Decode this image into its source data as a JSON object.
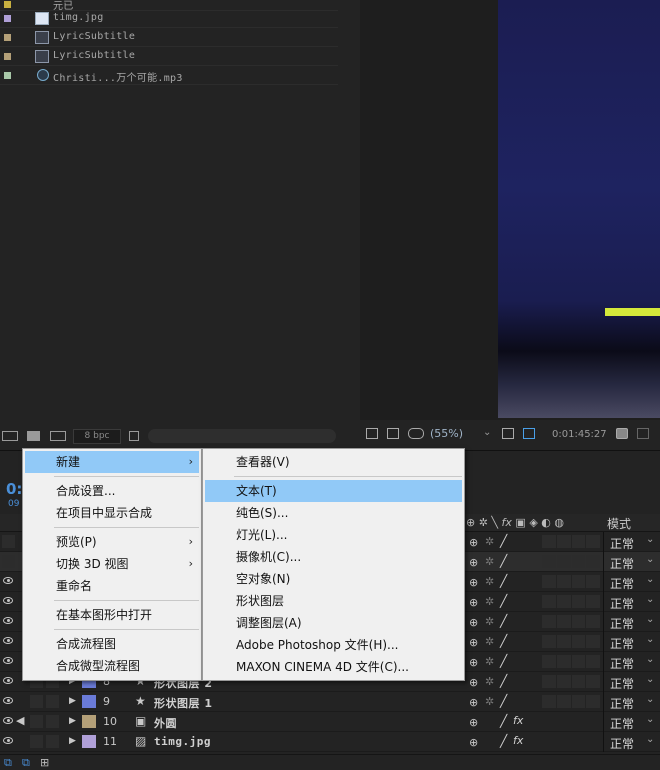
{
  "project": {
    "folder_partial": "元已",
    "items": [
      {
        "name": "timg.jpg",
        "type": "img",
        "swatch": "#b0a0d8"
      },
      {
        "name": "LyricSubtitle",
        "type": "comp",
        "swatch": "#b4a078"
      },
      {
        "name": "LyricSubtitle",
        "type": "comp",
        "swatch": "#b4a078"
      },
      {
        "name": "Christi...万个可能.mp3",
        "type": "audio",
        "swatch": "#a8c8a8"
      }
    ],
    "bpc": "8 bpc"
  },
  "viewer": {
    "zoom": "(55%)",
    "timecode": "0:01:45:27"
  },
  "timeline": {
    "timecode": "0:",
    "timecode_sub": "09",
    "mode_header": "模式",
    "fx_header": "fx",
    "mode_value": "正常",
    "layers": [
      {
        "num": "8",
        "name": "形状图层 2",
        "color": "#6a7bd8",
        "icon": "★"
      },
      {
        "num": "9",
        "name": "形状图层 1",
        "color": "#6a7bd8",
        "icon": "★"
      },
      {
        "num": "10",
        "name": "外圆",
        "color": "#b4a078",
        "icon": "▣",
        "fx": "fx"
      },
      {
        "num": "11",
        "name": "timg.jpg",
        "color": "#b0a0d8",
        "icon": "▨",
        "fx": "fx"
      }
    ]
  },
  "context_menu": {
    "items": [
      {
        "label": "新建",
        "submenu": true,
        "highlighted": true
      },
      {
        "label": "合成设置..."
      },
      {
        "label": "在项目中显示合成"
      },
      {
        "label": "预览(P)",
        "submenu": true
      },
      {
        "label": "切换 3D 视图",
        "submenu": true
      },
      {
        "label": "重命名"
      },
      {
        "label": "在基本图形中打开"
      },
      {
        "label": "合成流程图"
      },
      {
        "label": "合成微型流程图"
      }
    ],
    "arrow": "›"
  },
  "sub_menu": {
    "items": [
      {
        "label": "查看器(V)"
      },
      {
        "label": "文本(T)",
        "highlighted": true
      },
      {
        "label": "纯色(S)..."
      },
      {
        "label": "灯光(L)..."
      },
      {
        "label": "摄像机(C)..."
      },
      {
        "label": "空对象(N)"
      },
      {
        "label": "形状图层"
      },
      {
        "label": "调整图层(A)"
      },
      {
        "label": "Adobe Photoshop 文件(H)..."
      },
      {
        "label": "MAXON CINEMA 4D 文件(C)..."
      }
    ]
  },
  "colors": {
    "accent": "#4a8fd8",
    "menu_highlight": "#91c9f7",
    "viewer_bar": "#d4e83a"
  }
}
